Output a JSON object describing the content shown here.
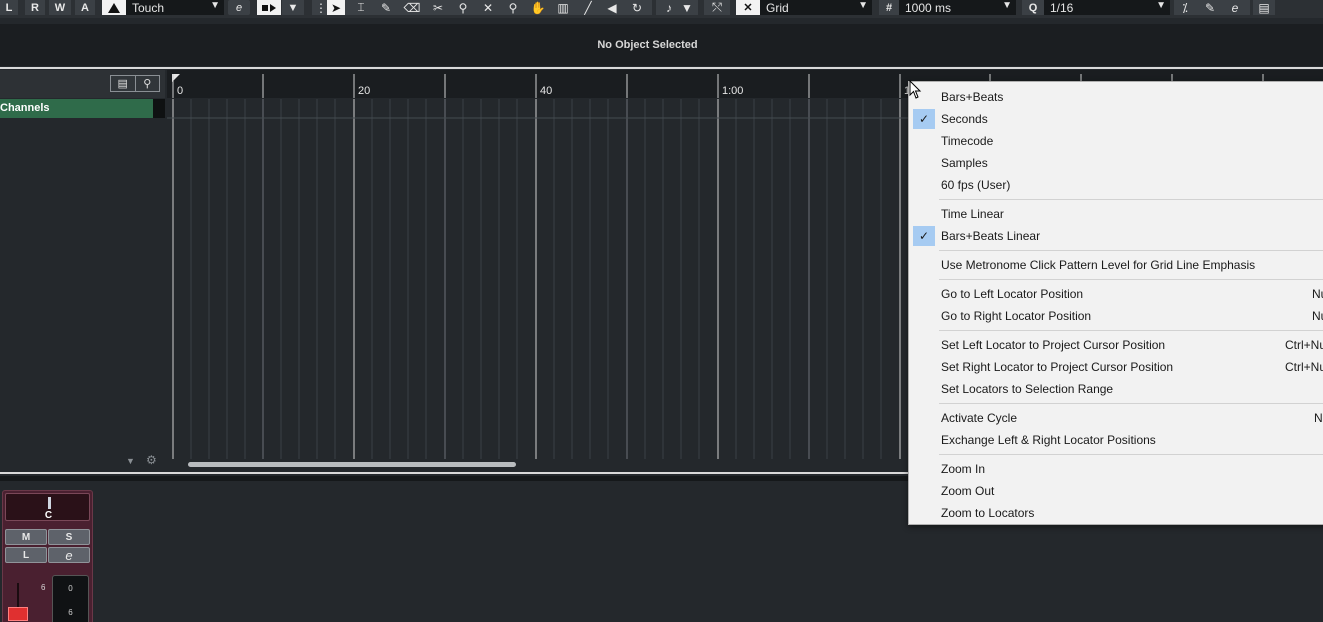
{
  "toolbar": {
    "automation_buttons": [
      "L",
      "R",
      "W",
      "A"
    ],
    "automation_mode": "Touch",
    "snap_type": "Grid",
    "grid_interval": "1000 ms",
    "quantize": "1/16",
    "e_label": "e"
  },
  "info_line": {
    "text": "No Object Selected"
  },
  "track_list": {
    "track_name": "Channels"
  },
  "ruler": {
    "labels": [
      "0",
      "20",
      "40",
      "1:00",
      "1"
    ]
  },
  "mixer_strip": {
    "pan_label": "C",
    "mute": "M",
    "solo": "S",
    "listen": "L",
    "edit": "e",
    "scale_6": "6",
    "meter_0": "0",
    "meter_6": "6"
  },
  "context_menu": {
    "items": [
      {
        "label": "Bars+Beats",
        "checked": false,
        "shortcut": ""
      },
      {
        "label": "Seconds",
        "checked": true,
        "shortcut": ""
      },
      {
        "label": "Timecode",
        "checked": false,
        "shortcut": ""
      },
      {
        "label": "Samples",
        "checked": false,
        "shortcut": ""
      },
      {
        "label": "60 fps (User)",
        "checked": false,
        "shortcut": ""
      },
      {
        "label": "Time Linear",
        "checked": false,
        "shortcut": ""
      },
      {
        "label": "Bars+Beats Linear",
        "checked": true,
        "shortcut": ""
      },
      {
        "label": "Use Metronome Click Pattern Level for Grid Line Emphasis",
        "checked": false,
        "shortcut": ""
      },
      {
        "label": "Go to Left Locator Position",
        "checked": false,
        "shortcut": "Nu"
      },
      {
        "label": "Go to Right Locator Position",
        "checked": false,
        "shortcut": "Nu"
      },
      {
        "label": "Set Left Locator to Project Cursor Position",
        "checked": false,
        "shortcut": "Ctrl+Nu"
      },
      {
        "label": "Set Right Locator to Project Cursor Position",
        "checked": false,
        "shortcut": "Ctrl+Nu"
      },
      {
        "label": "Set Locators to Selection Range",
        "checked": false,
        "shortcut": ""
      },
      {
        "label": "Activate Cycle",
        "checked": false,
        "shortcut": "N"
      },
      {
        "label": "Exchange Left & Right Locator Positions",
        "checked": false,
        "shortcut": ""
      },
      {
        "label": "Zoom In",
        "checked": false,
        "shortcut": ""
      },
      {
        "label": "Zoom Out",
        "checked": false,
        "shortcut": ""
      },
      {
        "label": "Zoom to Locators",
        "checked": false,
        "shortcut": ""
      }
    ],
    "check_glyph": "✓"
  }
}
